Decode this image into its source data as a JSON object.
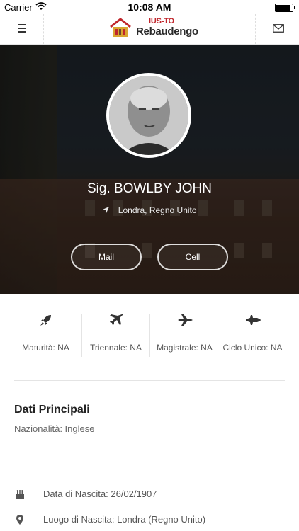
{
  "status_bar": {
    "carrier": "Carrier",
    "time": "10:08 AM"
  },
  "nav": {
    "logo_top": "IUS-TO",
    "logo_name": "Rebaudengo",
    "menu_icon": "hamburger-icon",
    "mail_icon": "envelope-icon"
  },
  "profile": {
    "name": "Sig. BOWLBY JOHN",
    "location": "Londra, Regno Unito",
    "buttons": {
      "mail": "Mail",
      "cell": "Cell"
    }
  },
  "stats": [
    {
      "icon": "rocket-icon",
      "label": "Maturità: NA"
    },
    {
      "icon": "airplane-icon",
      "label": "Triennale: NA"
    },
    {
      "icon": "fighter-jet-icon",
      "label": "Magistrale: NA"
    },
    {
      "icon": "space-shuttle-icon",
      "label": "Ciclo Unico: NA"
    }
  ],
  "main": {
    "title": "Dati Principali",
    "nationality": "Nazionalità: Inglese"
  },
  "details": [
    {
      "icon": "cake-icon",
      "text": "Data di Nascita: 26/02/1907"
    },
    {
      "icon": "map-pin-icon",
      "text": "Luogo di Nascita: Londra (Regno Unito)"
    }
  ],
  "colors": {
    "brand_red": "#c0262c",
    "text_dark": "#222222",
    "text_muted": "#666666"
  }
}
